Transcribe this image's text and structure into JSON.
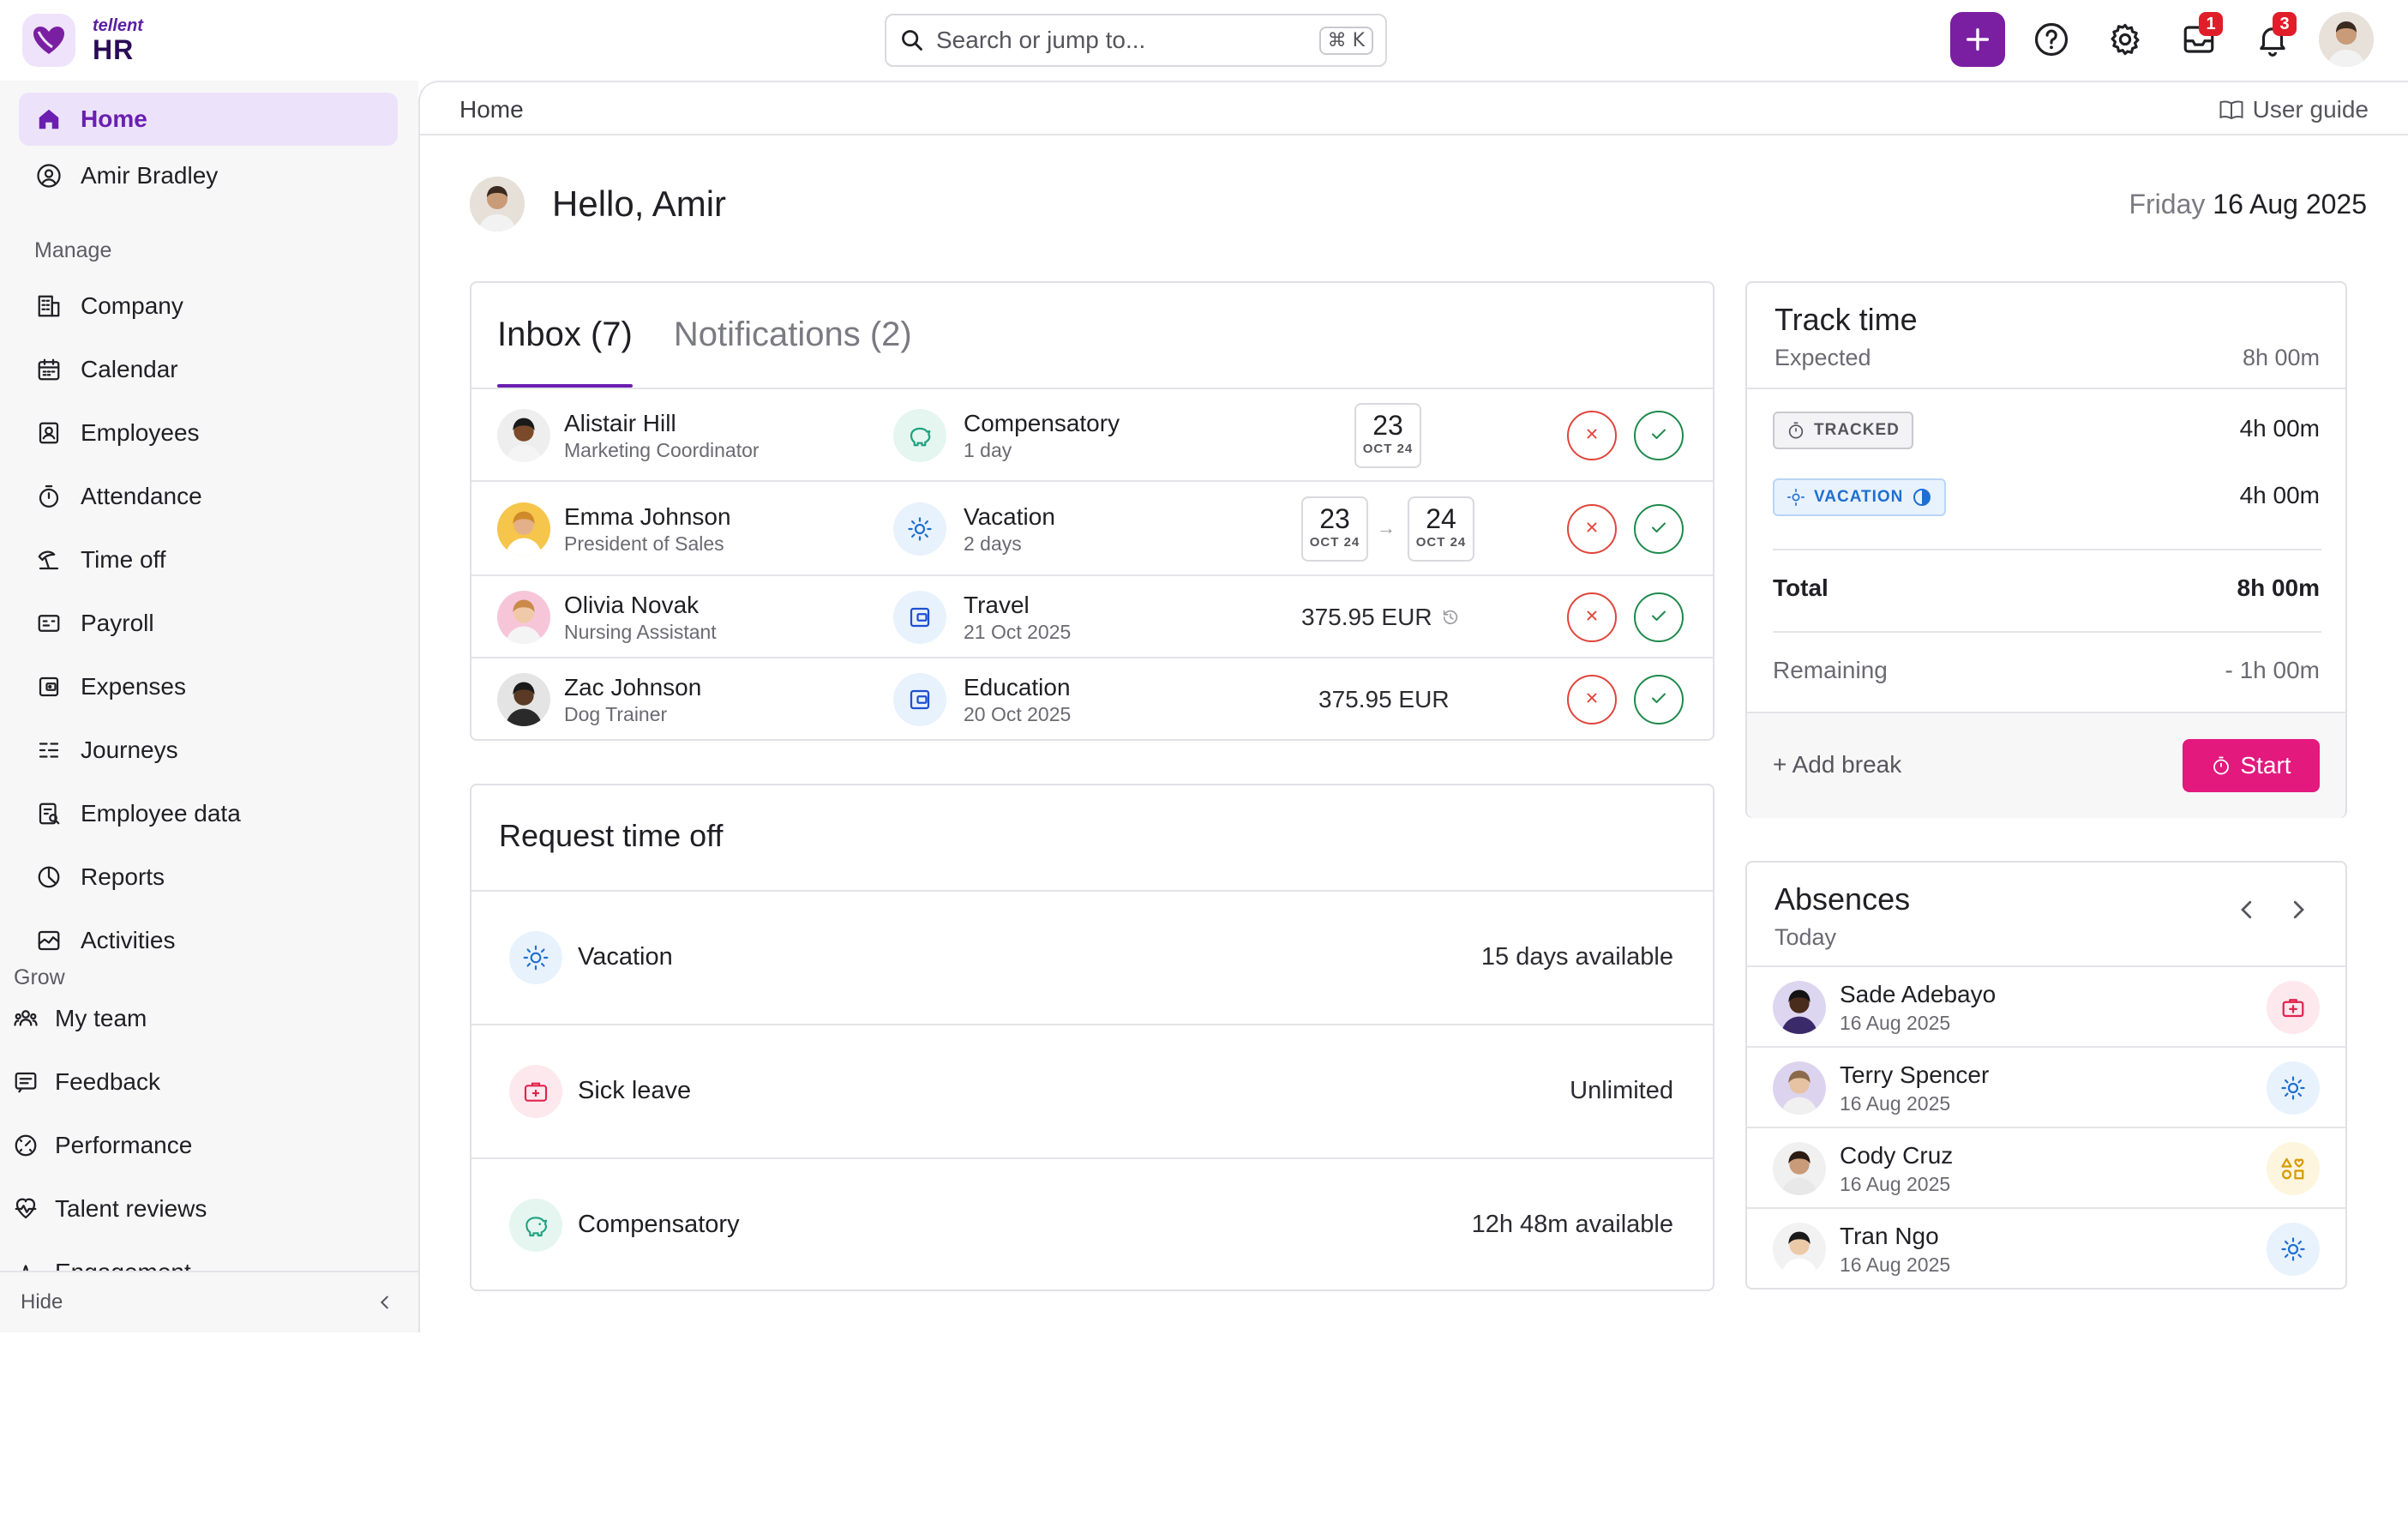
{
  "app": {
    "logo_small": "tellent",
    "logo_big": "HR"
  },
  "search": {
    "placeholder": "Search or jump to...",
    "shortcut": "⌘ K"
  },
  "topbar": {
    "inbox_badge": "1",
    "notifications_badge": "3"
  },
  "sidebar": {
    "home": "Home",
    "profile": "Amir Bradley",
    "manage_label": "Manage",
    "manage_items": [
      {
        "label": "Company",
        "icon": "building-icon"
      },
      {
        "label": "Calendar",
        "icon": "calendar-icon"
      },
      {
        "label": "Employees",
        "icon": "employees-icon"
      },
      {
        "label": "Attendance",
        "icon": "stopwatch-icon"
      },
      {
        "label": "Time off",
        "icon": "beach-icon"
      },
      {
        "label": "Payroll",
        "icon": "payroll-icon"
      },
      {
        "label": "Expenses",
        "icon": "wallet-icon"
      },
      {
        "label": "Journeys",
        "icon": "journeys-icon"
      },
      {
        "label": "Employee data",
        "icon": "data-icon"
      },
      {
        "label": "Reports",
        "icon": "pie-chart-icon"
      },
      {
        "label": "Activities",
        "icon": "activity-icon"
      }
    ],
    "grow_label": "Grow",
    "grow_items": [
      {
        "label": "My team",
        "icon": "team-icon"
      },
      {
        "label": "Feedback",
        "icon": "feedback-icon"
      },
      {
        "label": "Performance",
        "icon": "gauge-icon"
      },
      {
        "label": "Talent reviews",
        "icon": "heartbeat-icon"
      },
      {
        "label": "Engagement",
        "icon": "lotus-icon"
      }
    ],
    "hide_label": "Hide"
  },
  "main": {
    "breadcrumb": "Home",
    "user_guide": "User guide",
    "greeting": "Hello, Amir",
    "weekday": "Friday",
    "date": "16 Aug 2025"
  },
  "inbox": {
    "tab_inbox": "Inbox (7)",
    "tab_notifications": "Notifications (2)",
    "rows": [
      {
        "name": "Alistair Hill",
        "role": "Marketing Coordinator",
        "type": "Compensatory",
        "sub": "1 day",
        "date1_day": "23",
        "date1_month": "OCT 24"
      },
      {
        "name": "Emma Johnson",
        "role": "President of Sales",
        "type": "Vacation",
        "sub": "2 days",
        "date1_day": "23",
        "date1_month": "OCT 24",
        "date2_day": "24",
        "date2_month": "OCT 24"
      },
      {
        "name": "Olivia Novak",
        "role": "Nursing Assistant",
        "type": "Travel",
        "sub": "21 Oct 2025",
        "amount": "375.95 EUR"
      },
      {
        "name": "Zac Johnson",
        "role": "Dog Trainer",
        "type": "Education",
        "sub": "20 Oct 2025",
        "amount": "375.95 EUR"
      }
    ]
  },
  "request": {
    "title": "Request time off",
    "rows": [
      {
        "label": "Vacation",
        "value": "15 days available"
      },
      {
        "label": "Sick leave",
        "value": "Unlimited"
      },
      {
        "label": "Compensatory",
        "value": "12h 48m available"
      }
    ]
  },
  "track": {
    "title": "Track time",
    "expected_label": "Expected",
    "expected_value": "8h 00m",
    "tracked_label": "TRACKED",
    "tracked_value": "4h 00m",
    "vacation_label": "VACATION",
    "vacation_value": "4h 00m",
    "total_label": "Total",
    "total_value": "8h 00m",
    "remaining_label": "Remaining",
    "remaining_value": "- 1h 00m",
    "add_break": "+ Add break",
    "start": "Start"
  },
  "absences": {
    "title": "Absences",
    "subtitle": "Today",
    "rows": [
      {
        "name": "Sade Adebayo",
        "date": "16 Aug 2025",
        "icon": "medical-icon"
      },
      {
        "name": "Terry Spencer",
        "date": "16 Aug 2025",
        "icon": "sun-icon"
      },
      {
        "name": "Cody Cruz",
        "date": "16 Aug 2025",
        "icon": "shapes-icon"
      },
      {
        "name": "Tran Ngo",
        "date": "16 Aug 2025",
        "icon": "sun-icon"
      }
    ]
  },
  "colors": {
    "brand": "#6a1fb0",
    "accent_pink": "#e3197e",
    "reject": "#e0453c",
    "approve": "#1f8a4c"
  }
}
